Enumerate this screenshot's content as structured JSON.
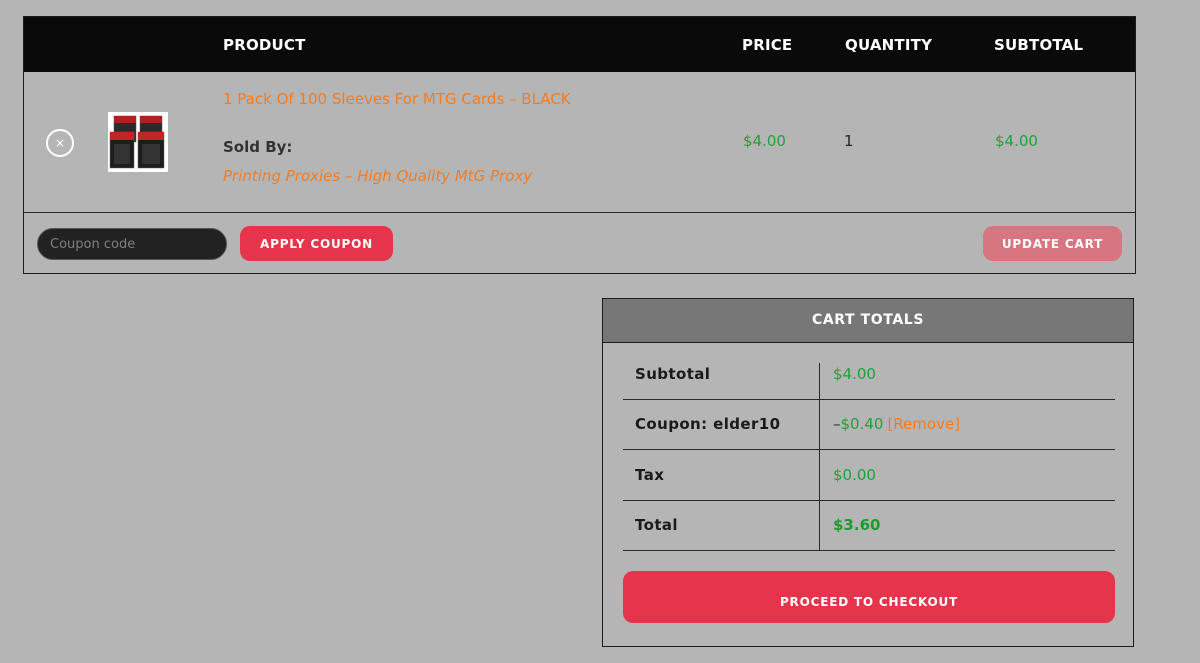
{
  "cart": {
    "columns": {
      "product": "PRODUCT",
      "price": "PRICE",
      "quantity": "QUANTITY",
      "subtotal": "SUBTOTAL"
    },
    "item": {
      "remove_label": "×",
      "name": "1 Pack Of 100 Sleeves For MTG Cards – BLACK",
      "sold_by_label": "Sold By:",
      "vendor": "Printing Proxies – High Quality MtG Proxy",
      "price": "$4.00",
      "quantity": "1",
      "subtotal": "$4.00"
    },
    "coupon_placeholder": "Coupon code",
    "apply_coupon_label": "APPLY COUPON",
    "update_cart_label": "UPDATE CART"
  },
  "totals": {
    "title": "CART TOTALS",
    "rows": [
      {
        "label": "Subtotal",
        "value": "$4.00"
      },
      {
        "label": "Coupon: elder10",
        "dash": "–",
        "value": "$0.40",
        "remove_label": "[Remove]"
      },
      {
        "label": "Tax",
        "value": "$0.00"
      },
      {
        "label": "Total",
        "value": "$3.60"
      }
    ],
    "checkout_label": "PROCEED TO CHECKOUT"
  },
  "colors": {
    "accent": "#e6344c",
    "link": "#f07d25",
    "money": "#22a03a",
    "header_bg": "#0a0a0a"
  },
  "icons": {
    "remove": "close-circle-icon",
    "product_image": "sleeves-pack-thumbnail"
  }
}
